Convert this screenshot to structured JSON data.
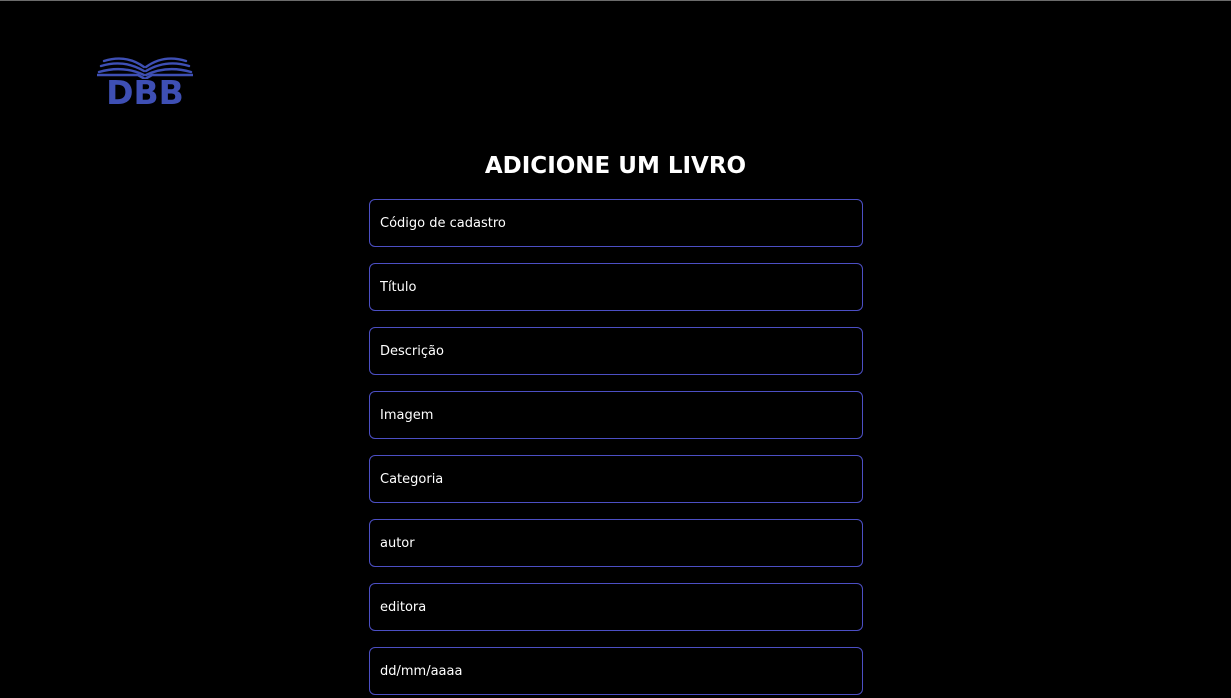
{
  "colors": {
    "background": "#000000",
    "accent": "#4c4fc4",
    "logo": "#3e4fb4",
    "text": "#ffffff"
  },
  "logo": {
    "icon": "open-book-icon",
    "text": "DBB"
  },
  "page": {
    "title": "ADICIONE UM LIVRO"
  },
  "form": {
    "fields": [
      {
        "name": "codigo-cadastro-input",
        "placeholder": "Código de cadastro"
      },
      {
        "name": "titulo-input",
        "placeholder": "Título"
      },
      {
        "name": "descricao-input",
        "placeholder": "Descrição"
      },
      {
        "name": "imagem-input",
        "placeholder": "Imagem"
      },
      {
        "name": "categoria-input",
        "placeholder": "Categoria"
      },
      {
        "name": "autor-input",
        "placeholder": "autor"
      },
      {
        "name": "editora-input",
        "placeholder": "editora"
      },
      {
        "name": "data-input",
        "placeholder": "dd/mm/aaaa"
      }
    ]
  }
}
